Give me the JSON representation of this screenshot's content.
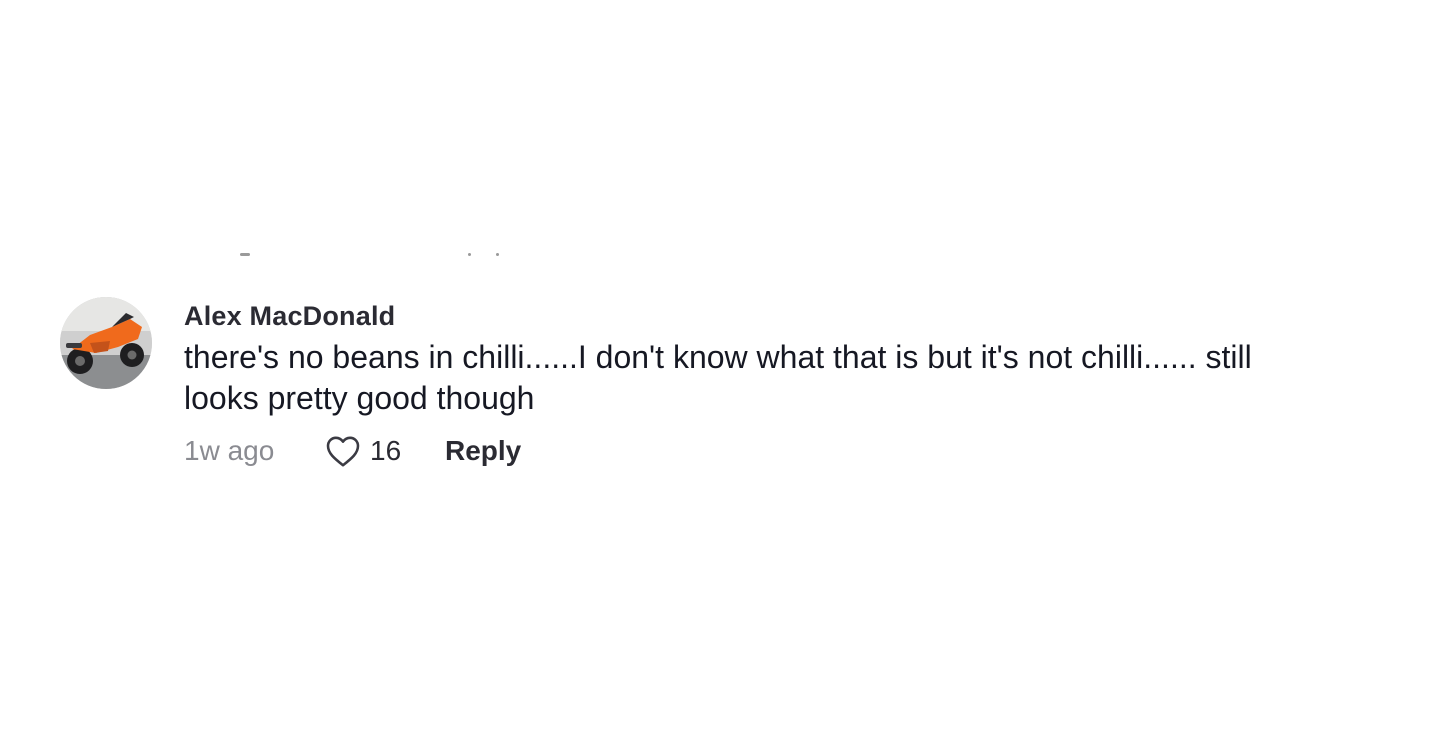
{
  "comment": {
    "username": "Alex MacDonald",
    "text": "there's no beans in chilli......I don't know what that is but it's not chilli...... still looks pretty good though",
    "time": "1w ago",
    "likes": "16",
    "reply_label": "Reply",
    "like_icon": "heart-outline-icon",
    "avatar_icon": "motorcycle-avatar"
  },
  "colors": {
    "text": "#161823",
    "secondary_text": "#8a8b91",
    "background": "#ffffff",
    "avatar_accent": "#f06a1c"
  }
}
